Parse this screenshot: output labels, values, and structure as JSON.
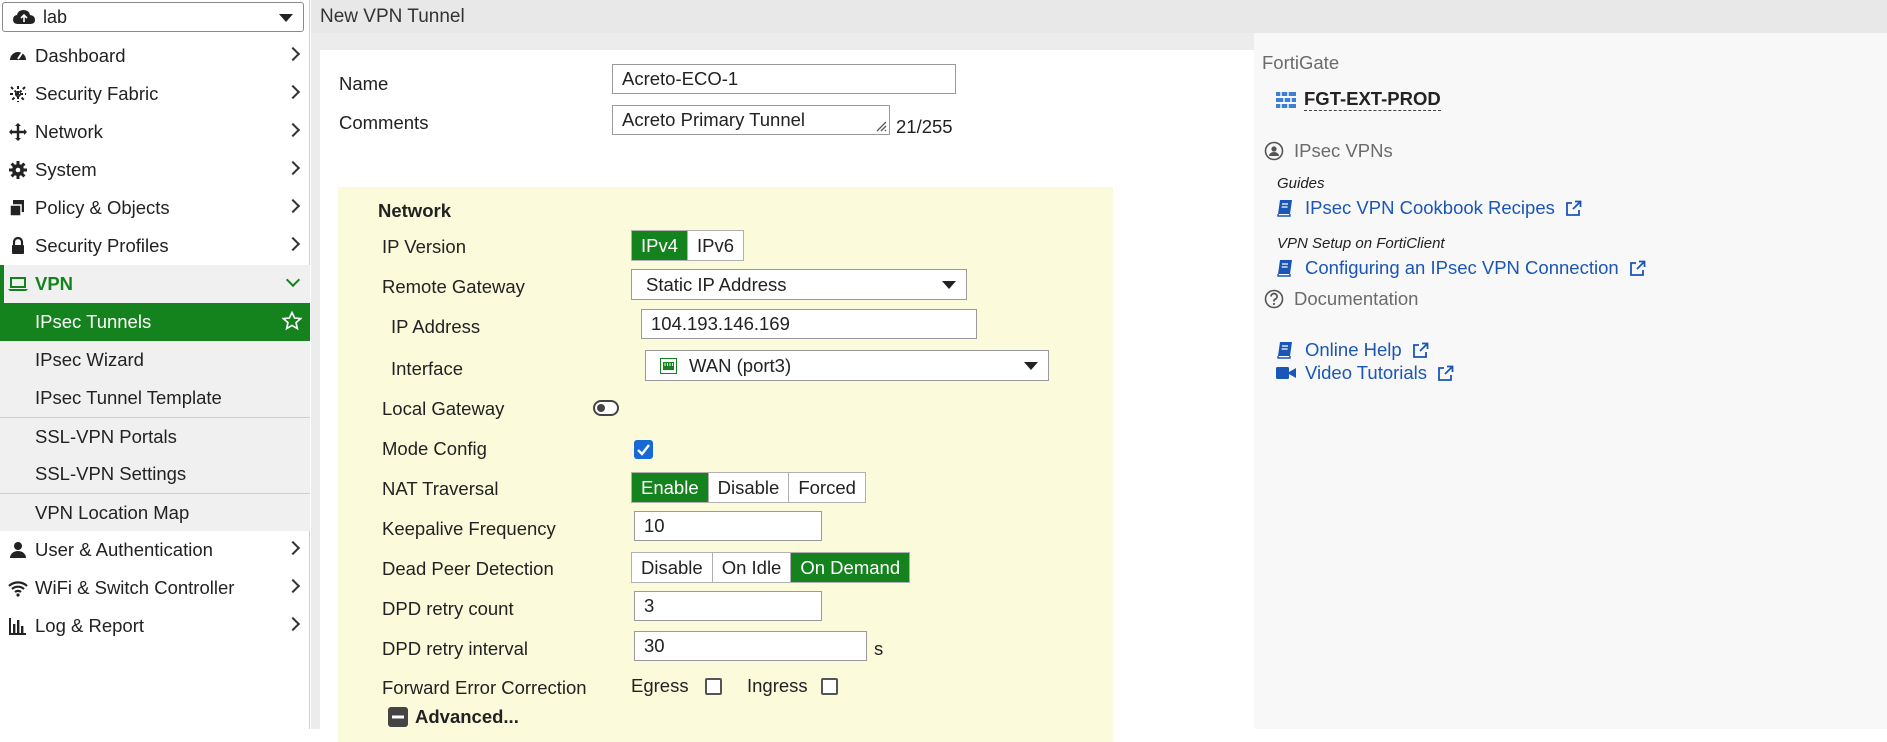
{
  "vdom": {
    "value": "lab"
  },
  "nav": {
    "dashboard": "Dashboard",
    "security_fabric": "Security Fabric",
    "network": "Network",
    "system": "System",
    "policy_objects": "Policy & Objects",
    "security_profiles": "Security Profiles",
    "vpn": "VPN",
    "user_auth": "User & Authentication",
    "wifi_switch": "WiFi & Switch Controller",
    "log_report": "Log & Report"
  },
  "vpn_sub": {
    "ipsec_tunnels": "IPsec Tunnels",
    "ipsec_wizard": "IPsec Wizard",
    "ipsec_template": "IPsec Tunnel Template",
    "sslvpn_portals": "SSL-VPN Portals",
    "sslvpn_settings": "SSL-VPN Settings",
    "vpn_location_map": "VPN Location Map"
  },
  "header": {
    "title": "New VPN Tunnel"
  },
  "form": {
    "name_label": "Name",
    "name_value": "Acreto-ECO-1",
    "comments_label": "Comments",
    "comments_value": "Acreto Primary Tunnel",
    "comments_counter": "21/255",
    "network_heading": "Network",
    "ip_version_label": "IP Version",
    "ip_version_options": [
      "IPv4",
      "IPv6"
    ],
    "remote_gateway_label": "Remote Gateway",
    "remote_gateway_value": "Static IP Address",
    "ip_address_label": "IP Address",
    "ip_address_value": "104.193.146.169",
    "interface_label": "Interface",
    "interface_value": "WAN (port3)",
    "local_gateway_label": "Local Gateway",
    "mode_config_label": "Mode Config",
    "nat_traversal_label": "NAT Traversal",
    "nat_options": [
      "Enable",
      "Disable",
      "Forced"
    ],
    "keepalive_label": "Keepalive Frequency",
    "keepalive_value": "10",
    "dpd_label": "Dead Peer Detection",
    "dpd_options": [
      "Disable",
      "On Idle",
      "On Demand"
    ],
    "dpd_retry_count_label": "DPD retry count",
    "dpd_retry_count_value": "3",
    "dpd_retry_interval_label": "DPD retry interval",
    "dpd_retry_interval_value": "30",
    "dpd_retry_interval_unit": "s",
    "fec_label": "Forward Error Correction",
    "fec_egress": "Egress",
    "fec_ingress": "Ingress",
    "advanced_label": "Advanced..."
  },
  "side": {
    "fortigate_title": "FortiGate",
    "device_name": "FGT-EXT-PROD",
    "ipsec_title": "IPsec VPNs",
    "guides_label": "Guides",
    "cookbook_link": "IPsec VPN Cookbook Recipes",
    "forticlient_label": "VPN Setup on FortiClient",
    "configuring_link": "Configuring an IPsec VPN Connection",
    "documentation_title": "Documentation",
    "online_help_link": "Online Help",
    "video_tutorials_link": "Video Tutorials"
  },
  "colors": {
    "accent": "#15831d",
    "link": "#1a56b8",
    "checkbox": "#1769d6",
    "network_bg": "#fbfbdc"
  }
}
